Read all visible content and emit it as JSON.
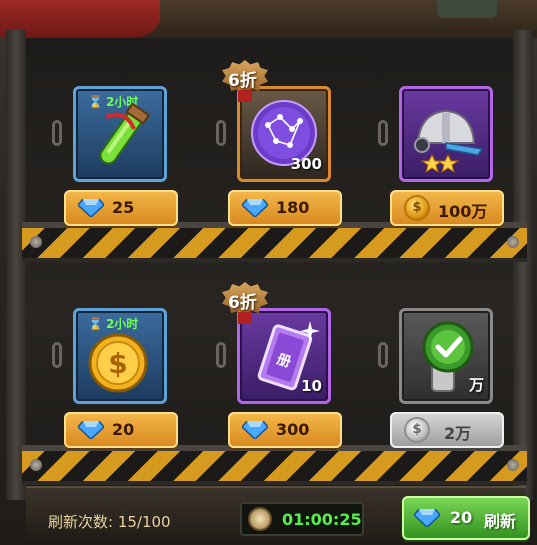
{
  "shelves": [
    {
      "items": [
        {
          "icon": "green-potion-icon",
          "frame": "blue",
          "timer": "2小时",
          "quantity": "",
          "discount": "",
          "currency": "diamond-icon",
          "price": "25"
        },
        {
          "icon": "purple-constellation-orb-icon",
          "frame": "orange",
          "timer": "",
          "quantity": "300",
          "discount": "6折",
          "currency": "diamond-icon",
          "price": "180"
        },
        {
          "icon": "silver-helmet-icon",
          "frame": "purple",
          "timer": "",
          "quantity": "",
          "discount": "",
          "currency": "gold-coin-icon",
          "price": "100万"
        }
      ]
    },
    {
      "items": [
        {
          "icon": "gold-dollar-coin-icon",
          "frame": "blue",
          "timer": "2小时",
          "quantity": "",
          "discount": "",
          "currency": "diamond-icon",
          "price": "20"
        },
        {
          "icon": "purple-ticket-icon",
          "frame": "purple",
          "timer": "",
          "quantity": "10",
          "discount": "6折",
          "currency": "diamond-icon",
          "price": "300"
        },
        {
          "icon": "green-check-seal-icon",
          "frame": "gray",
          "timer": "",
          "quantity": "万",
          "discount": "",
          "currency": "silver-coin-icon",
          "price": "2万"
        }
      ]
    }
  ],
  "footer": {
    "refresh_count": "刷新次数: 15/100",
    "countdown": "01:00:25",
    "refresh_price": "20",
    "refresh_label": "刷新"
  },
  "colors": {
    "timer_green": "#6dff55",
    "price_button": "#e9a23a",
    "refresh_button": "#4fb32f",
    "stripe_yellow": "#d69a1e"
  }
}
